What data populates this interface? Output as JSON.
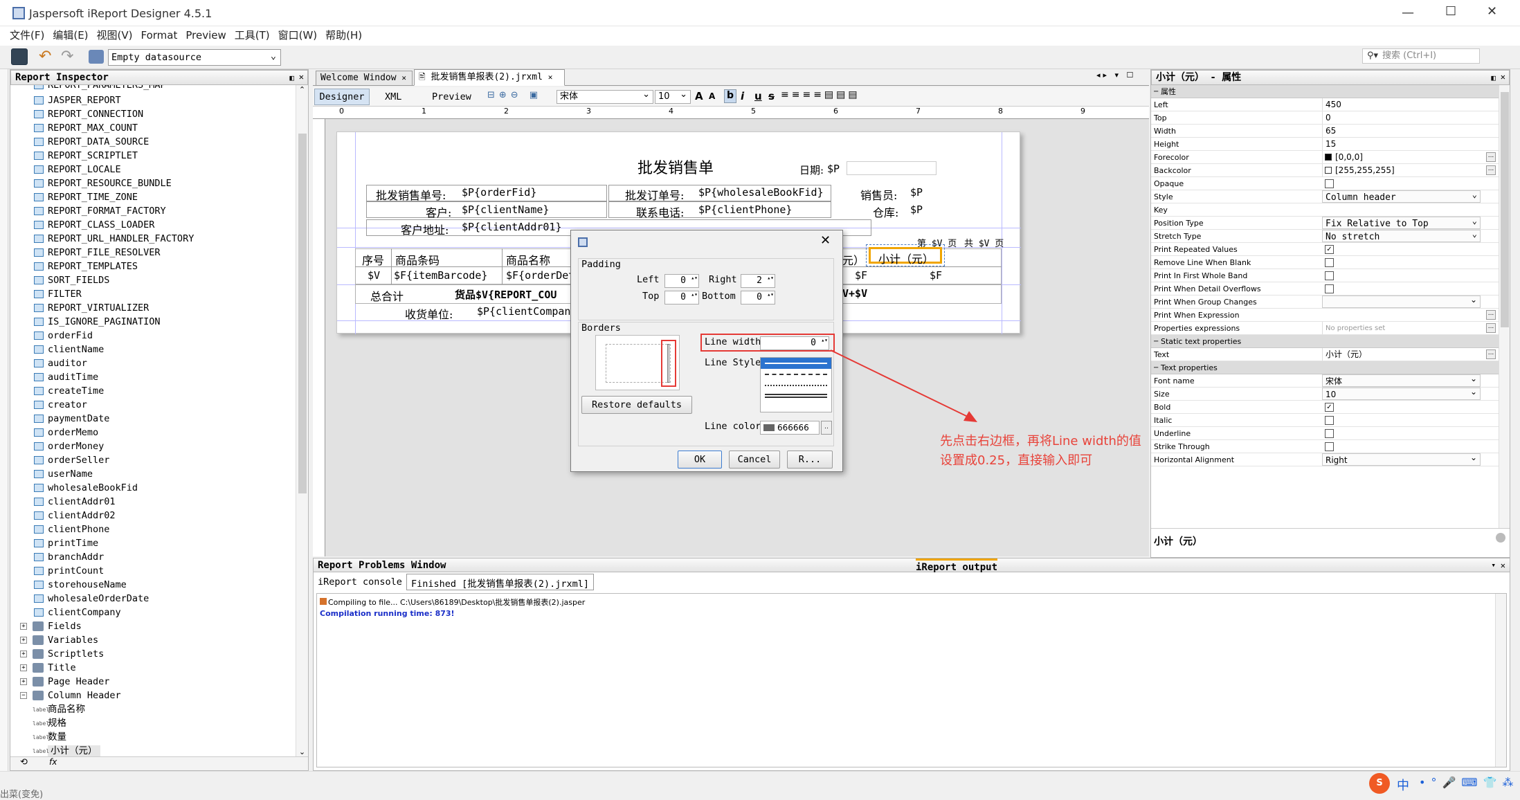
{
  "window": {
    "title": "Jaspersoft iReport Designer 4.5.1",
    "min": "—",
    "max": "☐",
    "close": "✕"
  },
  "menu": [
    "文件(F)",
    "编辑(E)",
    "视图(V)",
    "Format",
    "Preview",
    "工具(T)",
    "窗口(W)",
    "帮助(H)"
  ],
  "toolbar": {
    "datasource": "Empty datasource",
    "search_placeholder": "搜索 (Ctrl+I)"
  },
  "inspector": {
    "title": "Report Inspector",
    "cut_item": "REPORT_PARAMETERS_MAP",
    "params": [
      "JASPER_REPORT",
      "REPORT_CONNECTION",
      "REPORT_MAX_COUNT",
      "REPORT_DATA_SOURCE",
      "REPORT_SCRIPTLET",
      "REPORT_LOCALE",
      "REPORT_RESOURCE_BUNDLE",
      "REPORT_TIME_ZONE",
      "REPORT_FORMAT_FACTORY",
      "REPORT_CLASS_LOADER",
      "REPORT_URL_HANDLER_FACTORY",
      "REPORT_FILE_RESOLVER",
      "REPORT_TEMPLATES",
      "SORT_FIELDS",
      "FILTER",
      "REPORT_VIRTUALIZER",
      "IS_IGNORE_PAGINATION",
      "orderFid",
      "clientName",
      "auditor",
      "auditTime",
      "createTime",
      "creator",
      "paymentDate",
      "orderMemo",
      "orderMoney",
      "orderSeller",
      "userName",
      "wholesaleBookFid",
      "clientAddr01",
      "clientAddr02",
      "clientPhone",
      "printTime",
      "branchAddr",
      "printCount",
      "storehouseName",
      "wholesaleOrderDate",
      "clientCompany"
    ],
    "nodes": [
      "Fields",
      "Variables",
      "Scriptlets",
      "Title",
      "Page Header",
      "Column Header"
    ],
    "labels": [
      "商品名称",
      "规格",
      "数量",
      "小计（元）"
    ],
    "label_tag": "label"
  },
  "tabs": {
    "welcome": "Welcome Window",
    "file": "批发销售单报表(2).jrxml"
  },
  "editor": {
    "designer": "Designer",
    "xml": "XML",
    "preview": "Preview",
    "font": "宋体",
    "size": "10",
    "bold": "b",
    "italic": "i",
    "underline": "u",
    "strike": "s"
  },
  "ruler": [
    "0",
    "1",
    "2",
    "3",
    "4",
    "5",
    "6",
    "7",
    "8",
    "9"
  ],
  "report": {
    "title": "批发销售单",
    "date_label": "日期:",
    "date_val": "$P",
    "row1": [
      "批发销售单号:",
      "$P{orderFid}",
      "批发订单号:",
      "$P{wholesaleBookFid}",
      "销售员:",
      "$P"
    ],
    "row2": [
      "客户:",
      "$P{clientName}",
      "联系电话:",
      "$P{clientPhone}",
      "仓库:",
      "$P"
    ],
    "row3": [
      "客户地址:",
      "$P{clientAddr01}"
    ],
    "page_info": [
      "第 $V 页",
      "共 $V 页"
    ],
    "col_heads": [
      "序号",
      "商品条码",
      "商品名称",
      "元）",
      "小计（元）"
    ],
    "detail": [
      "$V",
      "$F{itemBarcode}",
      "$F{orderDet",
      "$F",
      "$F"
    ],
    "sum": [
      "总合计",
      "货品$V{REPORT_COU",
      "V+$V"
    ],
    "receiver": [
      "收货单位:",
      "$P{clientCompan"
    ]
  },
  "dialog": {
    "padding": "Padding",
    "left": "Left",
    "left_val": "0",
    "right": "Right",
    "right_val": "2",
    "top": "Top",
    "top_val": "0",
    "bottom": "Bottom",
    "bottom_val": "0",
    "borders": "Borders",
    "restore": "Restore defaults",
    "line_width": "Line width",
    "line_width_val": "0",
    "line_style": "Line Style",
    "line_color": "Line color",
    "line_color_val": "666666",
    "ok": "OK",
    "cancel": "Cancel",
    "r": "R..."
  },
  "annotation": {
    "line1": "先点击右边框，再将Line width的值",
    "line2": "设置成0.25，直接输入即可",
    "color": "#e8433a"
  },
  "props": {
    "title": "小计（元） - 属性",
    "section1": "属性",
    "rows1": [
      {
        "k": "Left",
        "v": "450"
      },
      {
        "k": "Top",
        "v": "0"
      },
      {
        "k": "Width",
        "v": "65"
      },
      {
        "k": "Height",
        "v": "15"
      },
      {
        "k": "Forecolor",
        "v": "[0,0,0]"
      },
      {
        "k": "Backcolor",
        "v": "[255,255,255]"
      }
    ],
    "opaque": "Opaque",
    "style": "Style",
    "style_val": "Column header",
    "key": "Key",
    "position": "Position Type",
    "position_val": "Fix Relative to Top",
    "stretch": "Stretch Type",
    "stretch_val": "No stretch",
    "checks": [
      "Print Repeated Values",
      "Remove Line When Blank",
      "Print In First Whole Band",
      "Print When Detail Overflows"
    ],
    "group_changes": "Print When Group Changes",
    "print_expr": "Print When Expression",
    "prop_expr": "Properties expressions",
    "prop_expr_val": "No properties set",
    "section2": "Static text properties",
    "text": "Text",
    "text_val": "小计（元）",
    "section3": "Text properties",
    "font_name": "Font name",
    "font_name_val": "宋体",
    "size": "Size",
    "size_val": "10",
    "bold": "Bold",
    "italic": "Italic",
    "underline": "Underline",
    "strike": "Strike Through",
    "cut": "Horizontal Alignment",
    "cut_val": "Right",
    "footer": "小计（元）"
  },
  "bottom": {
    "problems": "Report Problems Window",
    "output": "iReport output",
    "tab1": "iReport console",
    "tab2": "Finished [批发销售单报表(2).jrxml]",
    "line1": "Compiling to file... C:\\Users\\86189\\Desktop\\批发销售单报表(2).jasper",
    "line2": "Compilation running time: 873!"
  },
  "status": {
    "ime": "中",
    "bottom_cut": "出菜(变免)"
  }
}
